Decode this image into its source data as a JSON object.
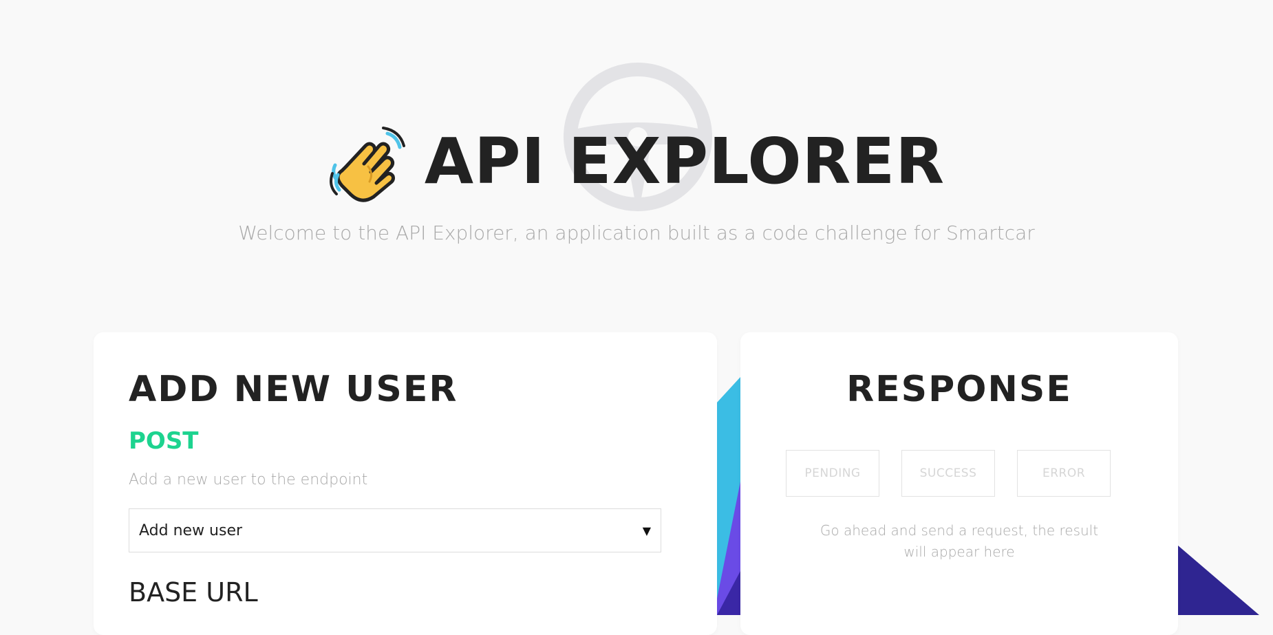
{
  "header": {
    "title": "API EXPLORER",
    "subtitle": "Welcome to the API Explorer, an application built as a code challenge for Smartcar"
  },
  "icons": {
    "title_icon": "waving-hand-icon",
    "watermark": "steering-wheel-logo"
  },
  "colors": {
    "background": "#f9f9f9",
    "method_post": "#1dd38f",
    "accent_cyan": "#3bbde4",
    "accent_purple": "#5b3ee0",
    "accent_indigo": "#2f2591"
  },
  "request_panel": {
    "title": "ADD NEW USER",
    "method": "POST",
    "description": "Add a new user to the endpoint",
    "selected_option": "Add new user",
    "base_url_label": "BASE URL"
  },
  "response_panel": {
    "title": "RESPONSE",
    "statuses": [
      "PENDING",
      "SUCCESS",
      "ERROR"
    ],
    "message": "Go ahead and send a request, the result will appear here"
  }
}
